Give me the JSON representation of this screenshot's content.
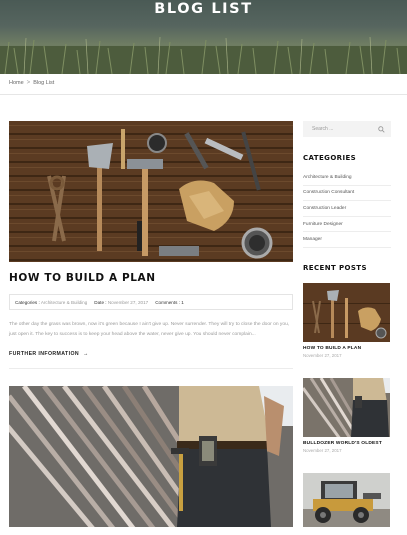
{
  "hero": {
    "title": "BLOG LIST"
  },
  "breadcrumb": {
    "home": "Home",
    "separator": ">",
    "current": "Blog List"
  },
  "post": {
    "title": "HOW TO BUILD A PLAN",
    "categories_label": "Categories :",
    "categories_value": "Architecture & Building",
    "date_label": "Date :",
    "date_value": "November 27, 2017",
    "comments_label": "Comments :",
    "comments_value": "1",
    "excerpt": "The other day the grass was brown, now it's green because I ain't give up. Never surrender. They will try to close the door on you, just open it. The key to success is to keep your head above the water, never give up. You should never complain...",
    "read_more": "FURTHER INFORMATION",
    "read_more_arrow": "→"
  },
  "sidebar": {
    "search_placeholder": "Search ...",
    "categories_title": "CATEGORIES",
    "categories": [
      "Architecture & Building",
      "Construction Consultant",
      "Construction Leader",
      "Furniture Designer",
      "Manager"
    ],
    "recent_title": "RECENT POSTS",
    "recent_posts": [
      {
        "title": "HOW TO BUILD A PLAN",
        "date": "November 27, 2017"
      },
      {
        "title": "BULLDOZER WORLD'S OLDEST",
        "date": "November 27, 2017"
      }
    ]
  },
  "colors": {
    "text_dark": "#111111",
    "muted": "#9a9a9a",
    "border": "#e4e4e4",
    "search_bg": "#f3f3f3"
  },
  "icons": {
    "search": "search-icon",
    "arrow": "arrow-right-icon"
  }
}
